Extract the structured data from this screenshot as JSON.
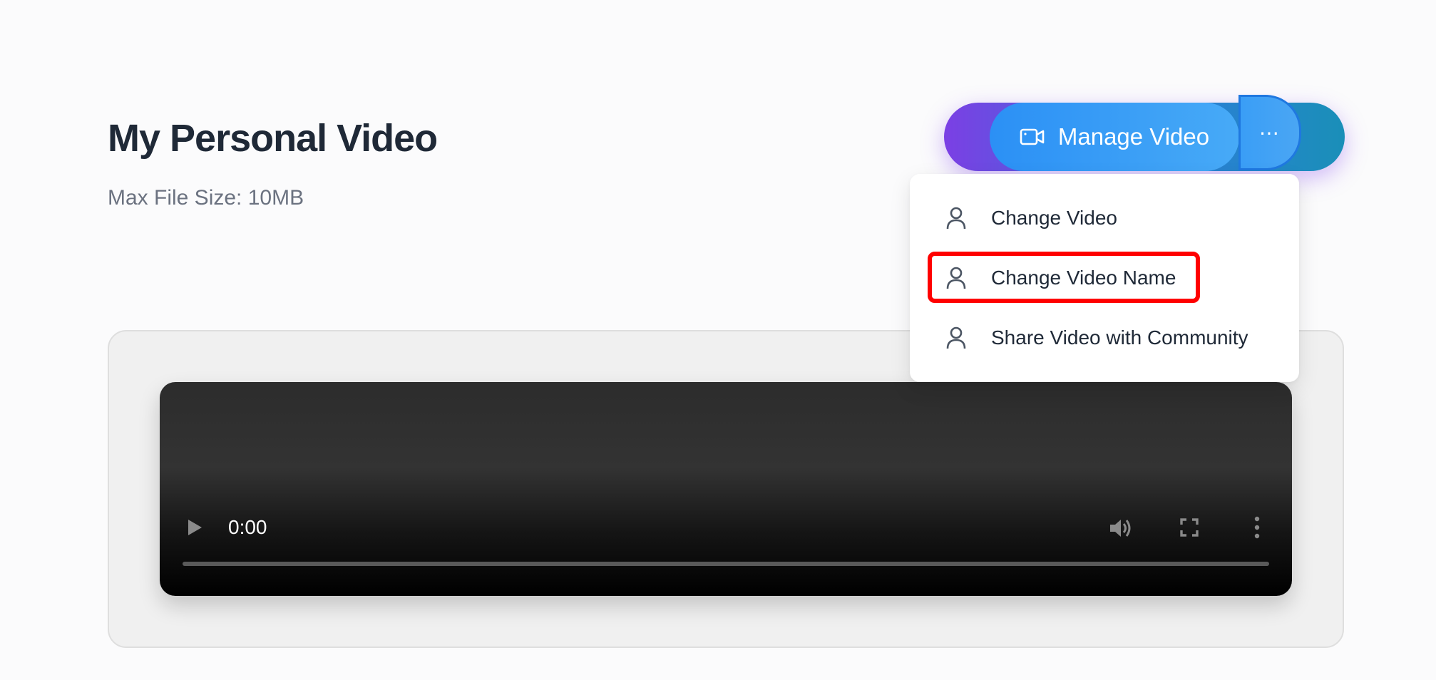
{
  "page": {
    "title": "My Personal Video",
    "file_size_note": "Max File Size: 10MB"
  },
  "manage": {
    "label": "Manage Video",
    "icon": "video-camera-icon",
    "more_label": "⋯"
  },
  "menu": {
    "items": [
      {
        "label": "Change Video",
        "icon": "user-icon"
      },
      {
        "label": "Change Video Name",
        "icon": "user-icon",
        "highlighted": true
      },
      {
        "label": "Share Video with Community",
        "icon": "user-icon"
      }
    ]
  },
  "player": {
    "time": "0:00",
    "progress": 0
  },
  "colors": {
    "accent_blue": "#2b90f5",
    "accent_purple": "#7b3fe4",
    "highlight_red": "#ff0000",
    "title_text": "#1f2937",
    "muted_text": "#6b7280"
  }
}
